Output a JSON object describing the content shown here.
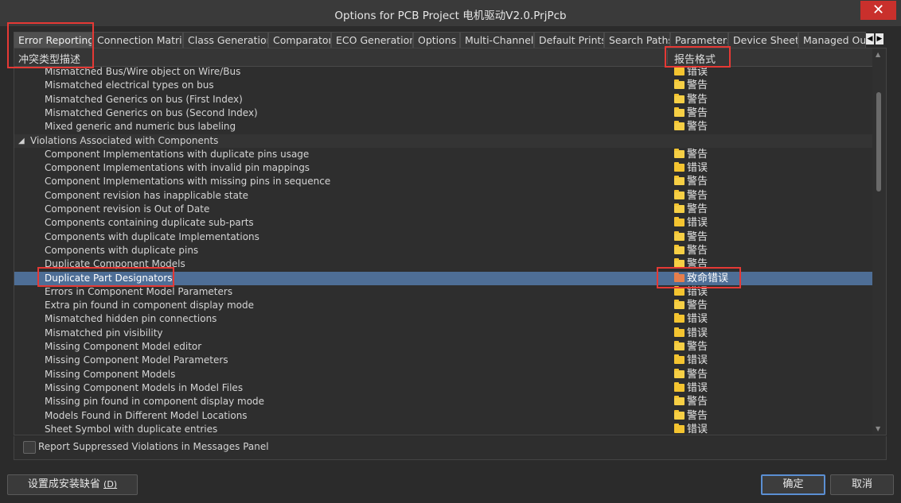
{
  "window": {
    "title": "Options for PCB Project 电机驱动V2.0.PrjPcb",
    "close_glyph": "✕"
  },
  "tabs": [
    {
      "label": "Error Reporting",
      "active": true
    },
    {
      "label": "Connection Matrix"
    },
    {
      "label": "Class Generation"
    },
    {
      "label": "Comparator"
    },
    {
      "label": "ECO Generation"
    },
    {
      "label": "Options"
    },
    {
      "label": "Multi-Channel"
    },
    {
      "label": "Default Prints"
    },
    {
      "label": "Search Paths"
    },
    {
      "label": "Parameters"
    },
    {
      "label": "Device Sheets"
    },
    {
      "label": "Managed Ou"
    }
  ],
  "tab_nav": {
    "prev": "◀",
    "next": "▶"
  },
  "table": {
    "col_description": "冲突类型描述",
    "col_report": "报告格式",
    "rows": [
      {
        "label": "Mismatched Bus/Wire object on Wire/Bus",
        "report": "错误",
        "level": "error"
      },
      {
        "label": "Mismatched electrical types on bus",
        "report": "警告",
        "level": "warning"
      },
      {
        "label": "Mismatched Generics on bus (First Index)",
        "report": "警告",
        "level": "warning"
      },
      {
        "label": "Mismatched Generics on bus (Second Index)",
        "report": "警告",
        "level": "warning"
      },
      {
        "label": "Mixed generic and numeric bus labeling",
        "report": "警告",
        "level": "warning"
      },
      {
        "label": "Violations Associated with Components",
        "group": true,
        "expand_glyph": "◢"
      },
      {
        "label": "Component Implementations with duplicate pins usage",
        "report": "警告",
        "level": "warning"
      },
      {
        "label": "Component Implementations with invalid pin mappings",
        "report": "错误",
        "level": "error"
      },
      {
        "label": "Component Implementations with missing pins in sequence",
        "report": "警告",
        "level": "warning"
      },
      {
        "label": "Component revision has inapplicable state",
        "report": "警告",
        "level": "warning"
      },
      {
        "label": "Component revision is Out of Date",
        "report": "警告",
        "level": "warning"
      },
      {
        "label": "Components containing duplicate sub-parts",
        "report": "错误",
        "level": "error"
      },
      {
        "label": "Components with duplicate Implementations",
        "report": "警告",
        "level": "warning"
      },
      {
        "label": "Components with duplicate pins",
        "report": "警告",
        "level": "warning"
      },
      {
        "label": "Duplicate Component Models",
        "report": "警告",
        "level": "warning"
      },
      {
        "label": "Duplicate Part Designators",
        "report": "致命错误",
        "level": "fatal",
        "selected": true
      },
      {
        "label": "Errors in Component Model Parameters",
        "report": "错误",
        "level": "error"
      },
      {
        "label": "Extra pin found in component display mode",
        "report": "警告",
        "level": "warning"
      },
      {
        "label": "Mismatched hidden pin connections",
        "report": "错误",
        "level": "error"
      },
      {
        "label": "Mismatched pin visibility",
        "report": "错误",
        "level": "error"
      },
      {
        "label": "Missing Component Model editor",
        "report": "警告",
        "level": "warning"
      },
      {
        "label": "Missing Component Model Parameters",
        "report": "错误",
        "level": "error"
      },
      {
        "label": "Missing Component Models",
        "report": "警告",
        "level": "warning"
      },
      {
        "label": "Missing Component Models in Model Files",
        "report": "错误",
        "level": "error"
      },
      {
        "label": "Missing pin found in component display mode",
        "report": "警告",
        "level": "warning"
      },
      {
        "label": "Models Found in Different Model Locations",
        "report": "警告",
        "level": "warning"
      },
      {
        "label": "Sheet Symbol with duplicate entries",
        "report": "错误",
        "level": "error"
      }
    ]
  },
  "scrollbar": {
    "up": "▲",
    "down": "▼"
  },
  "options": {
    "report_suppressed_label": "Report Suppressed Violations in Messages Panel",
    "checked": false
  },
  "buttons": {
    "set_default": "设置成安装缺省",
    "set_default_hotkey": "(D)",
    "ok": "确定",
    "cancel": "取消"
  },
  "colors": {
    "selection": "#4e6e96",
    "highlight_box": "#e53935",
    "folder_yellow": "#f4c430",
    "folder_fatal": "#e67e4b",
    "close_red": "#c9302c"
  }
}
